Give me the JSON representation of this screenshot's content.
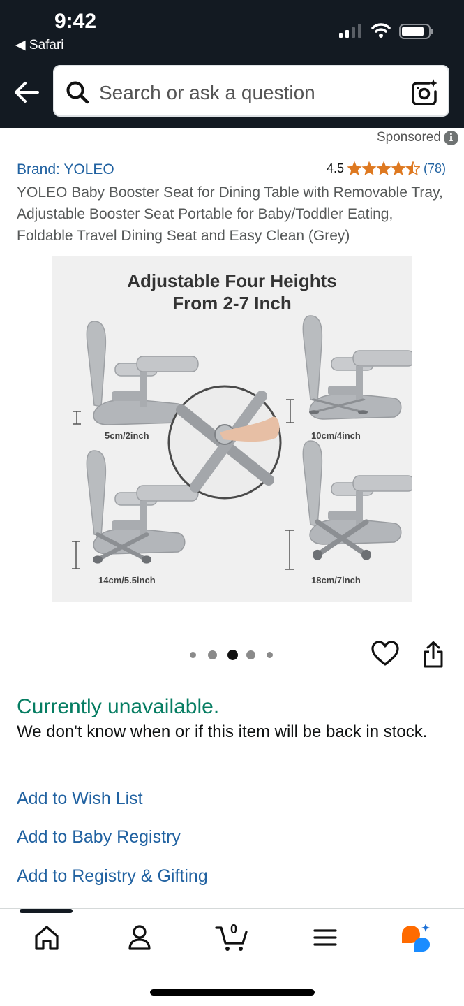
{
  "status_bar": {
    "time": "9:42",
    "back_app": "◀ Safari"
  },
  "search": {
    "placeholder": "Search or ask a question"
  },
  "sponsored": {
    "label": "Sponsored",
    "info_glyph": "i"
  },
  "product": {
    "brand": "Brand: YOLEO",
    "rating": "4.5",
    "rating_value": 4.5,
    "rating_max": 5,
    "review_count": "(78)",
    "title": "YOLEO Baby Booster Seat for Dining Table with Removable Tray, Adjustable Booster Seat Portable for Baby/Toddler Eating, Foldable Travel Dining Seat and Easy Clean (Grey)",
    "star_color": "#de7921"
  },
  "image": {
    "headline_line1": "Adjustable Four Heights",
    "headline_line2": "From 2-7 Inch",
    "labels": [
      "5cm/2inch",
      "10cm/4inch",
      "14cm/5.5inch",
      "18cm/7inch"
    ],
    "carousel_index": 3,
    "carousel_total": 5
  },
  "availability": {
    "status": "Currently unavailable.",
    "status_color": "#067d62",
    "message": "We don't know when or if this item will be back in stock."
  },
  "actions": {
    "wish_list": "Add to Wish List",
    "baby_registry": "Add to Baby Registry",
    "registry_gifting": "Add to Registry & Gifting"
  },
  "tab_bar": {
    "items": [
      "home-icon",
      "account-icon",
      "cart-icon",
      "menu-icon",
      "rufus-icon"
    ],
    "cart_count": "0"
  }
}
